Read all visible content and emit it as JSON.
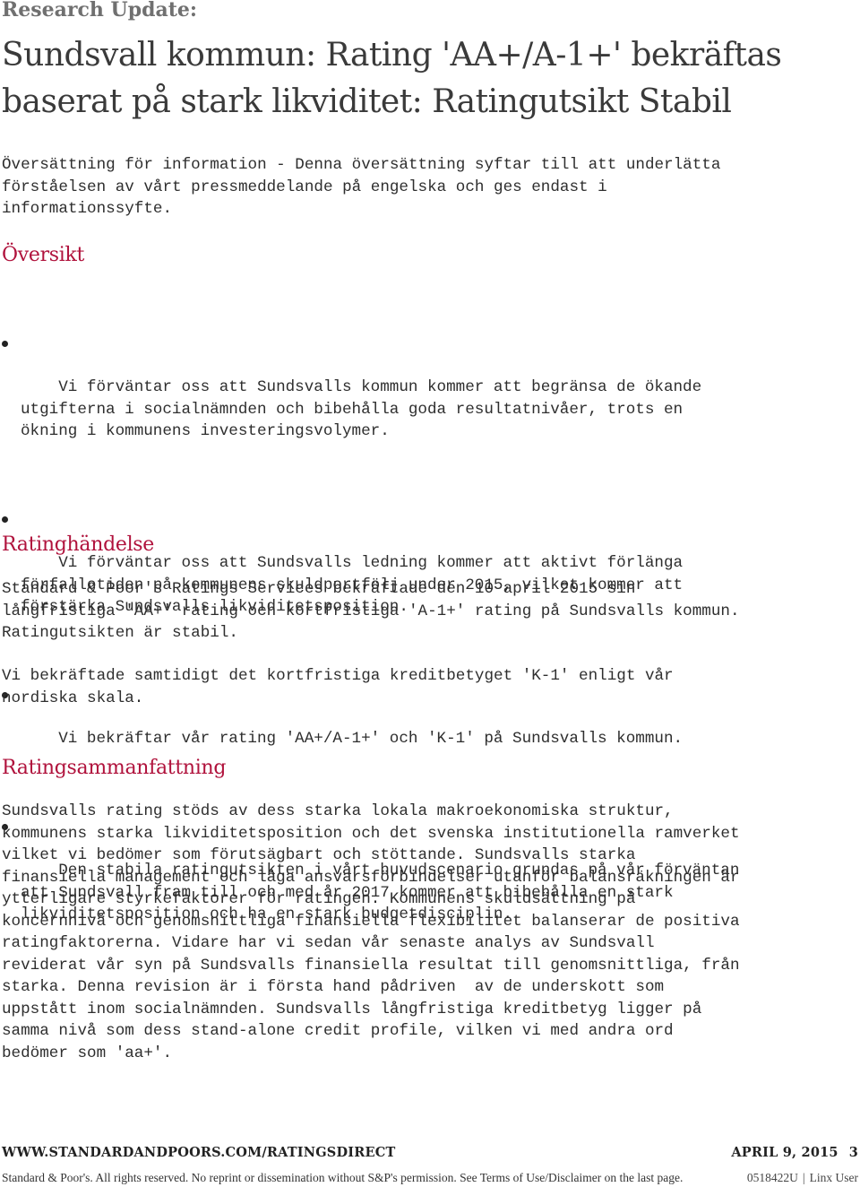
{
  "header": {
    "kicker": "Research Update:",
    "title": "Sundsvall kommun: Rating 'AA+/A-1+' bekräftas baserat på stark likviditet: Ratingutsikt Stabil"
  },
  "intro": "Översättning för information - Denna översättning syftar till att underlätta\nförståelsen av vårt pressmeddelande på engelska och ges endast i\ninformationssyfte.",
  "sections": {
    "overview": {
      "heading": "Översikt",
      "bullets": [
        "Vi förväntar oss att Sundsvalls kommun kommer att begränsa de ökande\nutgifterna i socialnämnden och bibehålla goda resultatnivåer, trots en\nökning i kommunens investeringsvolymer.",
        "Vi förväntar oss att Sundsvalls ledning kommer att aktivt förlänga\nförfallotiden på kommunens skuldportfölj under 2015, vilket kommer att\nförstärka Sundsvalls likviditetsposition.",
        "Vi bekräftar vår rating 'AA+/A-1+' och 'K-1' på Sundsvalls kommun.",
        "Den stabila ratingutsikten i vårt huvudscenario grundas på vår förväntan\natt Sundsvall fram till och med år 2017 kommer att bibehålla en stark\nlikviditetsposition och ha en stark budgetdisciplin."
      ]
    },
    "rating_action": {
      "heading": "Ratinghändelse",
      "paragraphs": [
        "Standard & Poor's Ratings Services bekräftade den 10 april 2015 sin\nlångfristiga 'AA+' rating och kortfristiga 'A-1+' rating på Sundsvalls kommun.\nRatingutsikten är stabil.",
        "Vi bekräftade samtidigt det kortfristiga kreditbetyget 'K-1' enligt vår\nnordiska skala."
      ]
    },
    "rationale": {
      "heading": "Ratingsammanfattning",
      "paragraph": "Sundsvalls rating stöds av dess starka lokala makroekonomiska struktur,\nkommunens starka likviditetsposition och det svenska institutionella ramverket\nvilket vi bedömer som förutsägbart och stöttande. Sundsvalls starka\nfinansiella management och låga ansvarsförbindelser utanför balansräkningen är\nytterligare styrkefaktorer för ratingen. Kommunens skuldsättning på\nkoncernnivå och genomsnittliga finansiella flexibilitet balanserar de positiva\nratingfaktorerna. Vidare har vi sedan vår senaste analys av Sundsvall\nreviderat vår syn på Sundsvalls finansiella resultat till genomsnittliga, från\nstarka. Denna revision är i första hand pådriven  av de underskott som\nuppstått inom socialnämnden. Sundsvalls långfristiga kreditbetyg ligger på\nsamma nivå som dess stand-alone credit profile, vilken vi med andra ord\nbedömer som 'aa+'."
    }
  },
  "footer": {
    "url": "WWW.STANDARDANDPOORS.COM/RATINGSDIRECT",
    "date": "APRIL 9, 2015",
    "page_number": "3",
    "legal": "Standard & Poor's. All rights reserved. No reprint or dissemination without S&P's permission. See Terms of Use/Disclaimer on the last page.",
    "doc_id": "0518422U",
    "separator": "|",
    "user": "Linx User"
  },
  "colors": {
    "heading_accent": "#b0123c",
    "kicker": "#707070",
    "title": "#3a3a3a"
  }
}
